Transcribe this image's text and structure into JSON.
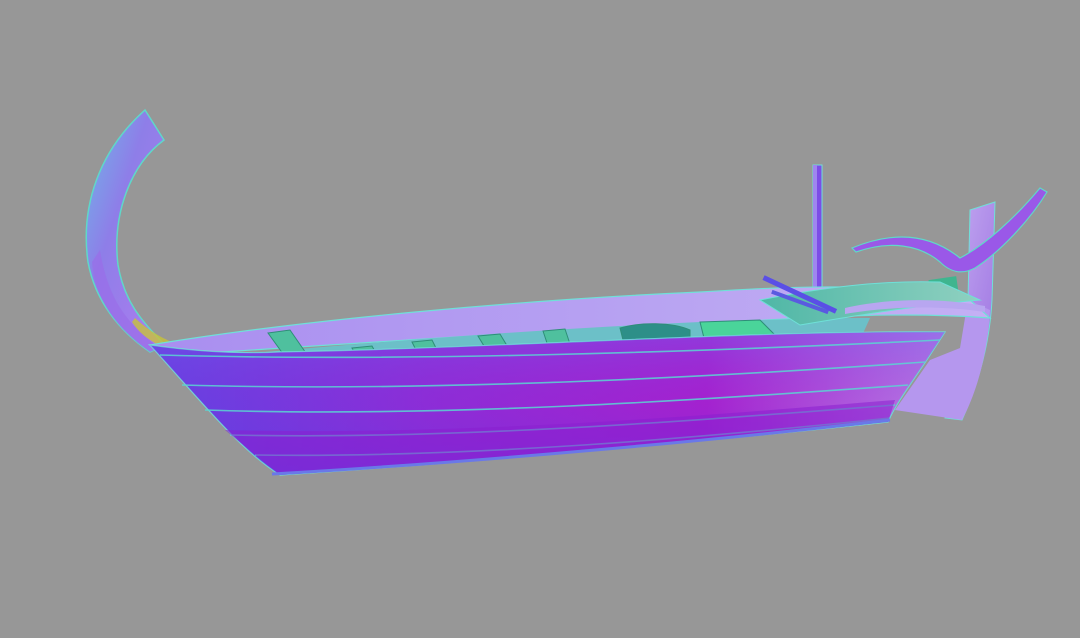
{
  "scene": {
    "background_color": "#979797",
    "subject": "boat-model",
    "render_style": "normal-map shading",
    "palette": {
      "hull_violet": "#6a3fe0",
      "hull_magenta": "#b01ed8",
      "hull_blue": "#4a4ee8",
      "rim_lavender": "#b59bf0",
      "deck_green": "#4cc79a",
      "interior_teal": "#69b9c8",
      "edge_cyan": "#6fe0d8",
      "stern_light": "#c7b0f2"
    }
  }
}
